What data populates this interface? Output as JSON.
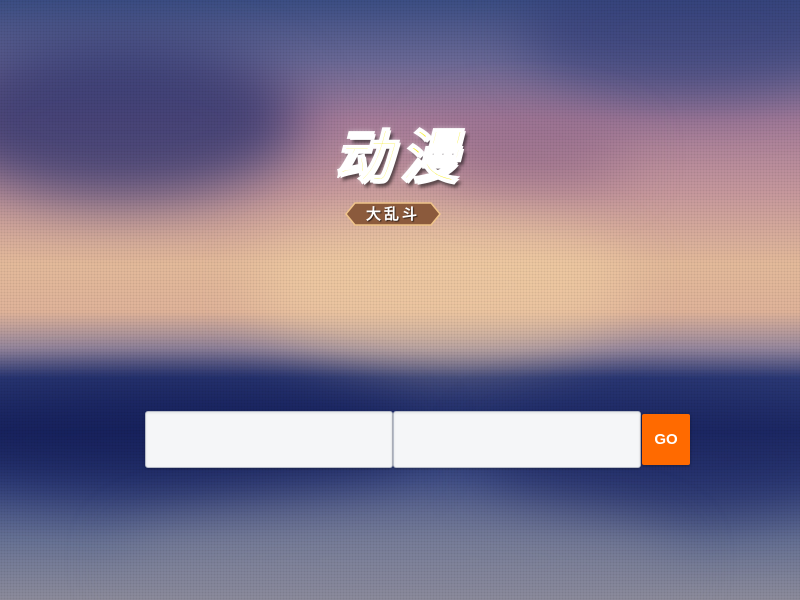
{
  "logo": {
    "main_text": "动漫",
    "sub_text": "大乱斗"
  },
  "search": {
    "field_1": {
      "value": "",
      "placeholder": ""
    },
    "field_2": {
      "value": "",
      "placeholder": ""
    },
    "go_label": "GO"
  },
  "colors": {
    "go_button": "#ff6a00",
    "logo_text": "#f6ee2a",
    "badge_fill": "#8b5a3c"
  }
}
